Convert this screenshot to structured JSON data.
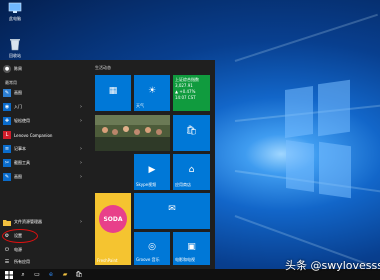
{
  "desktop": {
    "icons": [
      {
        "label": "此电脑",
        "icon": "computer-icon"
      },
      {
        "label": "回收站",
        "icon": "recycle-bin-icon"
      }
    ]
  },
  "start_menu": {
    "user_label": "陈周",
    "most_used_header": "最常用",
    "apps": [
      {
        "label": "画图",
        "icon": "paint-icon",
        "color": "#2d7fd2"
      },
      {
        "label": "入门",
        "icon": "get-started-icon",
        "color": "#0a6ccc",
        "has_arrow": true
      },
      {
        "label": "轻松使用",
        "icon": "accessibility-icon",
        "color": "#0a6ccc",
        "has_arrow": true
      },
      {
        "label": "Lenovo Companion",
        "icon": "lenovo-icon",
        "color": "#d01e2b"
      },
      {
        "label": "记事本",
        "icon": "notepad-icon",
        "color": "#0a6ccc",
        "has_arrow": true
      },
      {
        "label": "截图工具",
        "icon": "snipping-icon",
        "color": "#0a6ccc",
        "has_arrow": true
      },
      {
        "label": "画图",
        "icon": "paint-icon",
        "color": "#0a6ccc",
        "has_arrow": true
      }
    ],
    "bottom": [
      {
        "label": "文件资源管理器",
        "icon": "folder-icon",
        "has_arrow": true
      },
      {
        "label": "设置",
        "icon": "gear-icon"
      },
      {
        "label": "电源",
        "icon": "power-icon"
      },
      {
        "label": "所有应用",
        "icon": "apps-list-icon"
      }
    ],
    "tile_group": "生活动态",
    "tiles": {
      "calendar": {
        "label": "",
        "icon": "calendar-icon"
      },
      "mail": {
        "label": "",
        "icon": "mail-icon"
      },
      "weather": {
        "label": "天气",
        "icon": "sun-icon"
      },
      "money": {
        "title": "上证综合指数",
        "value": "3,027.91",
        "change": "▲ +0.47%",
        "time": "14:07 CST"
      },
      "store_label": "应用商店",
      "skype_label": "Skype视频",
      "groove_label": "Groove 音乐",
      "movies_label": "电影和电视",
      "candy_label": "FreshPaint",
      "candy_text": "SODA"
    }
  },
  "taskbar": {
    "icons": [
      "windows-logo-icon",
      "search-icon",
      "task-view-icon",
      "edge-icon",
      "explorer-icon",
      "store-icon"
    ]
  },
  "watermark": "头条 @swylovesss"
}
